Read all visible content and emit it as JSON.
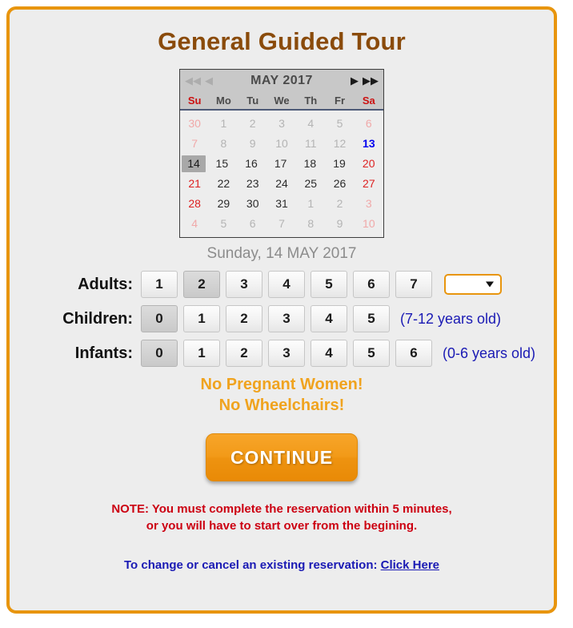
{
  "page": {
    "title": "General Guided Tour",
    "accent_border_color": "#E8950E",
    "background_color": "#EDEDED"
  },
  "calendar": {
    "month_label": "MAY 2017",
    "nav": {
      "prev_year": "◀◀",
      "prev_month": "◀",
      "next_month": "▶",
      "next_year": "▶▶"
    },
    "day_headers": [
      "Su",
      "Mo",
      "Tu",
      "We",
      "Th",
      "Fr",
      "Sa"
    ],
    "weeks": [
      [
        {
          "n": "30",
          "state": "other"
        },
        {
          "n": "1",
          "state": "other"
        },
        {
          "n": "2",
          "state": "other"
        },
        {
          "n": "3",
          "state": "other"
        },
        {
          "n": "4",
          "state": "other"
        },
        {
          "n": "5",
          "state": "other"
        },
        {
          "n": "6",
          "state": "other"
        }
      ],
      [
        {
          "n": "7",
          "state": "past"
        },
        {
          "n": "8",
          "state": "past"
        },
        {
          "n": "9",
          "state": "past"
        },
        {
          "n": "10",
          "state": "past"
        },
        {
          "n": "11",
          "state": "past"
        },
        {
          "n": "12",
          "state": "past"
        },
        {
          "n": "13",
          "state": "today"
        }
      ],
      [
        {
          "n": "14",
          "state": "selected"
        },
        {
          "n": "15",
          "state": "normal"
        },
        {
          "n": "16",
          "state": "normal"
        },
        {
          "n": "17",
          "state": "normal"
        },
        {
          "n": "18",
          "state": "normal"
        },
        {
          "n": "19",
          "state": "normal"
        },
        {
          "n": "20",
          "state": "normal"
        }
      ],
      [
        {
          "n": "21",
          "state": "normal"
        },
        {
          "n": "22",
          "state": "normal"
        },
        {
          "n": "23",
          "state": "normal"
        },
        {
          "n": "24",
          "state": "normal"
        },
        {
          "n": "25",
          "state": "normal"
        },
        {
          "n": "26",
          "state": "normal"
        },
        {
          "n": "27",
          "state": "normal"
        }
      ],
      [
        {
          "n": "28",
          "state": "normal"
        },
        {
          "n": "29",
          "state": "normal"
        },
        {
          "n": "30",
          "state": "normal"
        },
        {
          "n": "31",
          "state": "normal"
        },
        {
          "n": "1",
          "state": "other"
        },
        {
          "n": "2",
          "state": "other"
        },
        {
          "n": "3",
          "state": "other"
        }
      ],
      [
        {
          "n": "4",
          "state": "other"
        },
        {
          "n": "5",
          "state": "other"
        },
        {
          "n": "6",
          "state": "other"
        },
        {
          "n": "7",
          "state": "other"
        },
        {
          "n": "8",
          "state": "other"
        },
        {
          "n": "9",
          "state": "other"
        },
        {
          "n": "10",
          "state": "other"
        }
      ]
    ],
    "selected_date_label": "Sunday, 14 MAY 2017"
  },
  "selectors": {
    "adults": {
      "label": "Adults:",
      "options": [
        "1",
        "2",
        "3",
        "4",
        "5",
        "6",
        "7"
      ],
      "selected": "2",
      "dropdown": {
        "value": "",
        "caret_icon": "chevron-down-icon"
      }
    },
    "children": {
      "label": "Children:",
      "options": [
        "0",
        "1",
        "2",
        "3",
        "4",
        "5"
      ],
      "selected": "0",
      "hint": "(7-12 years old)"
    },
    "infants": {
      "label": "Infants:",
      "options": [
        "0",
        "1",
        "2",
        "3",
        "4",
        "5",
        "6"
      ],
      "selected": "0",
      "hint": "(0-6 years old)"
    }
  },
  "warnings": [
    "No Pregnant Women!",
    "No Wheelchairs!"
  ],
  "cta": {
    "label": "CONTINUE"
  },
  "note": {
    "line1": "NOTE: You must complete the reservation within 5 minutes,",
    "line2": "or you will have to start over from the begining."
  },
  "footer": {
    "text": "To change or cancel an existing reservation: ",
    "link_label": "Click Here"
  }
}
